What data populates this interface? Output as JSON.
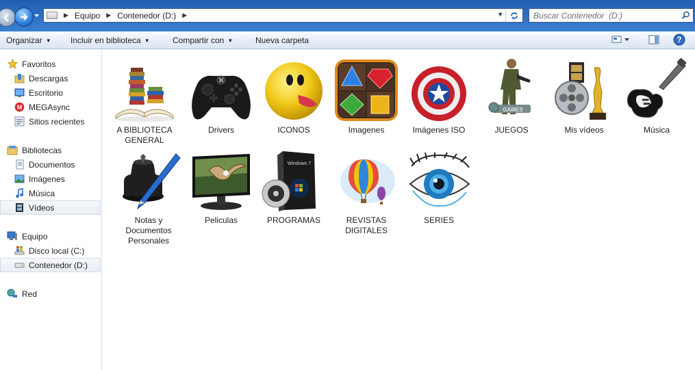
{
  "address_bar": {
    "breadcrumbs": [
      "Equipo",
      "Contenedor  (D:)"
    ],
    "search_placeholder": "Buscar Contenedor  (D:)"
  },
  "toolbar": {
    "organize": "Organizar",
    "include_library": "Incluir en biblioteca",
    "share_with": "Compartir con",
    "new_folder": "Nueva carpeta"
  },
  "sidebar": {
    "favorites": {
      "label": "Favoritos",
      "items": [
        "Descargas",
        "Escritorio",
        "MEGAsync",
        "Sitios recientes"
      ]
    },
    "libraries": {
      "label": "Bibliotecas",
      "items": [
        "Documentos",
        "Imágenes",
        "Música",
        "Vídeos"
      ]
    },
    "computer": {
      "label": "Equipo",
      "items": [
        "Disco local (C:)",
        "Contenedor  (D:)"
      ]
    },
    "network": {
      "label": "Red"
    },
    "selected": [
      "Vídeos",
      "Contenedor  (D:)"
    ]
  },
  "folders": [
    {
      "name": "A BIBLIOTECA GENERAL",
      "icon": "book-stack-icon"
    },
    {
      "name": "Drivers",
      "icon": "xbox-controller-icon"
    },
    {
      "name": "ICONOS",
      "icon": "pacman-icon"
    },
    {
      "name": "Imagenes",
      "icon": "gems-icon"
    },
    {
      "name": "Imágenes ISO",
      "icon": "captain-america-shield-icon"
    },
    {
      "name": "JUEGOS",
      "icon": "soldier-icon"
    },
    {
      "name": "Mis vídeos",
      "icon": "film-reel-oscar-icon"
    },
    {
      "name": "Música",
      "icon": "electric-guitar-icon"
    },
    {
      "name": "Notas y Documentos Personales",
      "icon": "ink-pen-icon"
    },
    {
      "name": "Peliculas",
      "icon": "monitor-eagle-icon"
    },
    {
      "name": "PROGRAMAS",
      "icon": "windows7-box-icon"
    },
    {
      "name": "REVISTAS DIGITALES",
      "icon": "hot-air-balloon-icon"
    },
    {
      "name": "SERIES",
      "icon": "eye-icon"
    }
  ],
  "colors": {
    "window_chrome": "#2f73c7",
    "toolbar_bg": "#e6eef8",
    "selection_bg": "#e9eef4"
  }
}
